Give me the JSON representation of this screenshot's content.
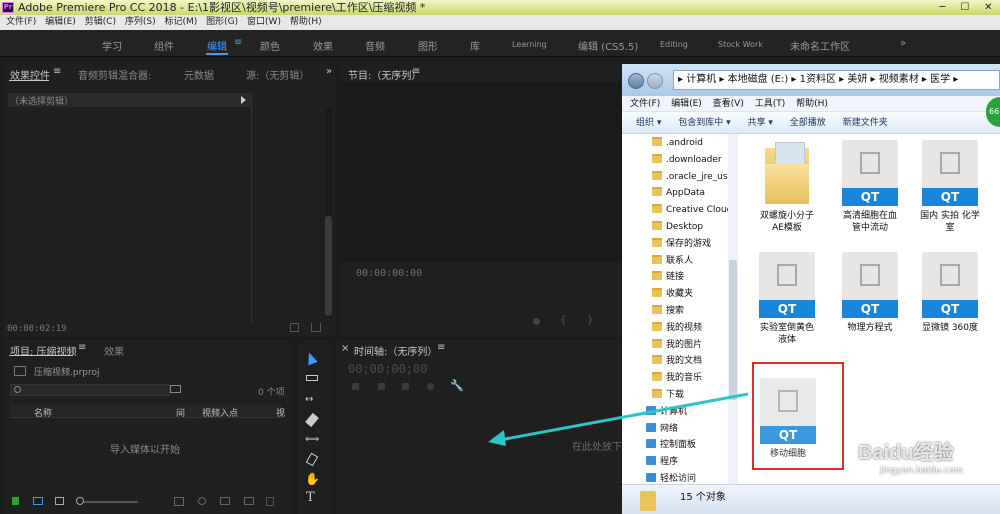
{
  "app": {
    "title": "Adobe Premiere Pro CC 2018 - E:\\1影视区\\视频号\\premiere\\工作区\\压缩视频 *",
    "logo": "Pr",
    "window_controls": [
      "─",
      "☐",
      "✕"
    ],
    "menu": [
      "文件(F)",
      "编辑(E)",
      "剪辑(C)",
      "序列(S)",
      "标记(M)",
      "图形(G)",
      "窗口(W)",
      "帮助(H)"
    ],
    "workspaces": [
      "学习",
      "组件",
      "编辑",
      "颜色",
      "效果",
      "音频",
      "图形",
      "库",
      "Learning",
      "编辑 (CS5.5)",
      "Editing",
      "Stock Work",
      "未命名工作区"
    ],
    "workspace_menu_icon": "≡",
    "overflow": "»"
  },
  "source_panel": {
    "tabs": [
      "效果控件",
      "音频剪辑混合器:",
      "元数据",
      "源:（无剪辑）"
    ],
    "menu_icon": "≡",
    "overflow": "»",
    "no_clip": "（未选择剪辑）",
    "timecode": "00:00:02:19"
  },
  "program_panel": {
    "title": "节目:（无序列）",
    "menu_icon": "≡",
    "timecode": "00:00:00:00"
  },
  "project_panel": {
    "title": "项目: 压缩视频",
    "menu_icon": "≡",
    "tab2": "效果",
    "file": "压缩视频.prproj",
    "count": "0 个项",
    "columns": [
      "名称",
      "间",
      "视频入点",
      "视"
    ],
    "empty": "导入媒体以开始"
  },
  "timeline_panel": {
    "title": "时间轴:（无序列）",
    "menu_icon": "≡",
    "timecode": "00;00;00;00",
    "drop_hint": "在此处放下"
  },
  "tools": [
    "selection-tool",
    "track-select-tool",
    "ripple-edit-tool",
    "razor-tool",
    "slip-tool",
    "pen-tool",
    "hand-tool",
    "type-tool"
  ],
  "explorer": {
    "address": "▸ 计算机 ▸ 本地磁盘 (E:) ▸ 1资料区 ▸ 美妍 ▸ 视频素材 ▸ 医学 ▸",
    "menu": [
      "文件(F)",
      "编辑(E)",
      "查看(V)",
      "工具(T)",
      "帮助(H)"
    ],
    "toolbar": [
      "组织 ▾",
      "包含到库中 ▾",
      "共享 ▾",
      "全部播放",
      "新建文件夹"
    ],
    "nav": [
      {
        "label": ".android",
        "icon": "folder"
      },
      {
        "label": ".downloader",
        "icon": "folder"
      },
      {
        "label": ".oracle_jre_usa",
        "icon": "folder"
      },
      {
        "label": "AppData",
        "icon": "folder"
      },
      {
        "label": "Creative Cloud",
        "icon": "folder"
      },
      {
        "label": "Desktop",
        "icon": "folder"
      },
      {
        "label": "保存的游戏",
        "icon": "folder"
      },
      {
        "label": "联系人",
        "icon": "folder"
      },
      {
        "label": "链接",
        "icon": "folder"
      },
      {
        "label": "收藏夹",
        "icon": "folder"
      },
      {
        "label": "搜索",
        "icon": "folder"
      },
      {
        "label": "我的视频",
        "icon": "folder"
      },
      {
        "label": "我的图片",
        "icon": "folder"
      },
      {
        "label": "我的文档",
        "icon": "folder"
      },
      {
        "label": "我的音乐",
        "icon": "folder"
      },
      {
        "label": "下载",
        "icon": "folder"
      },
      {
        "label": "计算机",
        "icon": "computer"
      },
      {
        "label": "网络",
        "icon": "network"
      },
      {
        "label": "控制面板",
        "icon": "control-panel"
      },
      {
        "label": "程序",
        "icon": "program"
      },
      {
        "label": "轻松访问",
        "icon": "accessibility"
      }
    ],
    "files": [
      {
        "name": "双螺旋小分子AE模板",
        "type": "folder"
      },
      {
        "name": "高清细胞在血管中流动",
        "type": "QT"
      },
      {
        "name": "国内 实拍 化学室",
        "type": "QT"
      },
      {
        "name": "实验室倒黄色液体",
        "type": "QT"
      },
      {
        "name": "物理方程式",
        "type": "QT"
      },
      {
        "name": "显微镜 360度",
        "type": "QT"
      },
      {
        "name": "移动细胞",
        "type": "QT"
      }
    ],
    "qt_label": "QT",
    "status": "15 个对象",
    "badge": "66"
  },
  "watermark": {
    "brand": "Baidu经验",
    "url": "jingyan.baidu.com"
  },
  "colors": {
    "accent": "#3d9cff",
    "qt_blue": "#1a86d9",
    "highlight": "#e02b2b",
    "arrow": "#2bc4c8"
  }
}
